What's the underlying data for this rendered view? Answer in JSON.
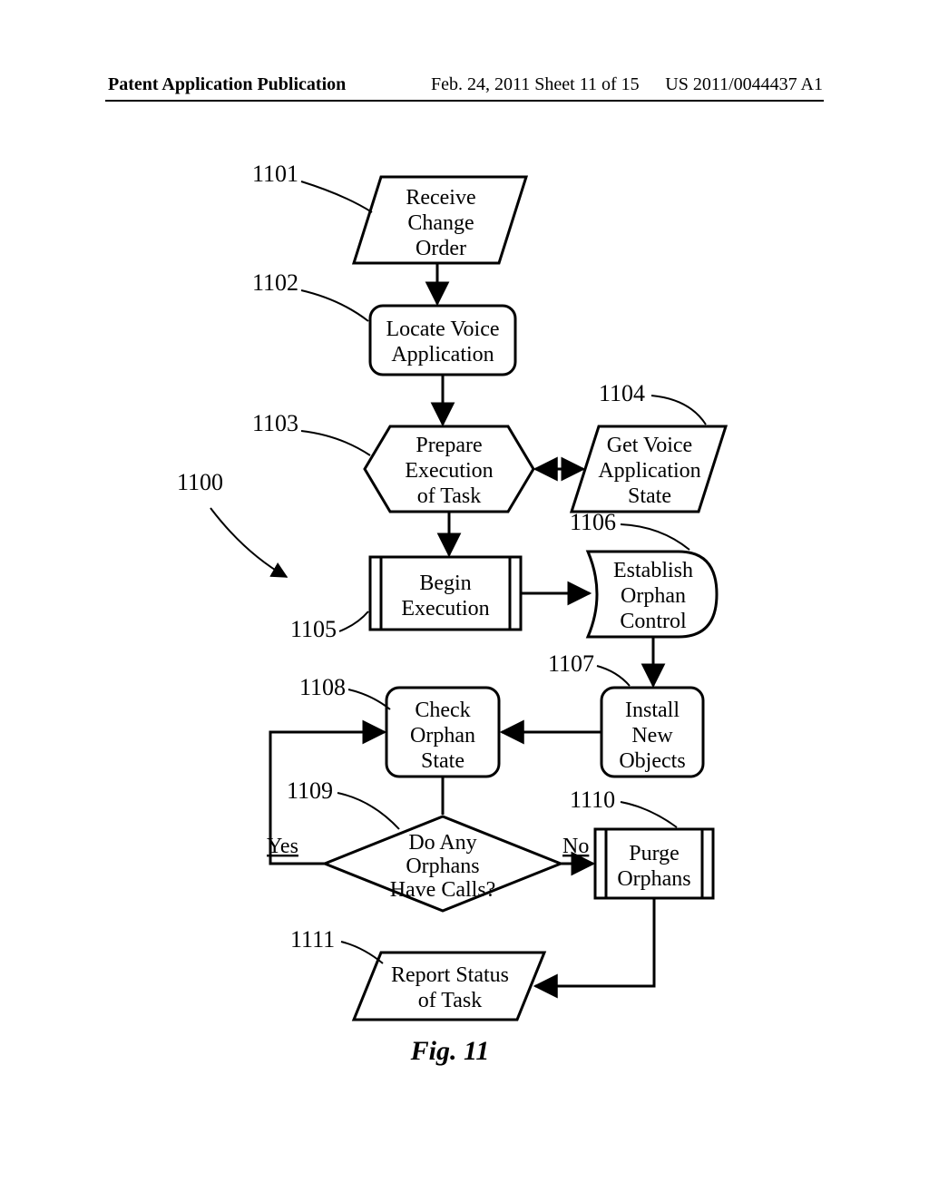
{
  "header": {
    "left": "Patent Application Publication",
    "center": "Feb. 24, 2011   Sheet 11 of 15",
    "right": "US 2011/0044437 A1"
  },
  "refs": {
    "r1100": "1100",
    "r1101": "1101",
    "r1102": "1102",
    "r1103": "1103",
    "r1104": "1104",
    "r1105": "1105",
    "r1106": "1106",
    "r1107": "1107",
    "r1108": "1108",
    "r1109": "1109",
    "r1110": "1110",
    "r1111": "1111"
  },
  "nodes": {
    "n1101_l1": "Receive",
    "n1101_l2": "Change",
    "n1101_l3": "Order",
    "n1102_l1": "Locate Voice",
    "n1102_l2": "Application",
    "n1103_l1": "Prepare",
    "n1103_l2": "Execution",
    "n1103_l3": "of Task",
    "n1104_l1": "Get Voice",
    "n1104_l2": "Application",
    "n1104_l3": "State",
    "n1105_l1": "Begin",
    "n1105_l2": "Execution",
    "n1106_l1": "Establish",
    "n1106_l2": "Orphan",
    "n1106_l3": "Control",
    "n1107_l1": "Install",
    "n1107_l2": "New",
    "n1107_l3": "Objects",
    "n1108_l1": "Check",
    "n1108_l2": "Orphan",
    "n1108_l3": "State",
    "n1109_l1": "Do Any",
    "n1109_l2": "Orphans",
    "n1109_l3": "Have Calls?",
    "n1110_l1": "Purge",
    "n1110_l2": "Orphans",
    "n1111_l1": "Report Status",
    "n1111_l2": "of Task"
  },
  "edges": {
    "yes": "Yes",
    "no": "No"
  },
  "caption": "Fig. 11"
}
